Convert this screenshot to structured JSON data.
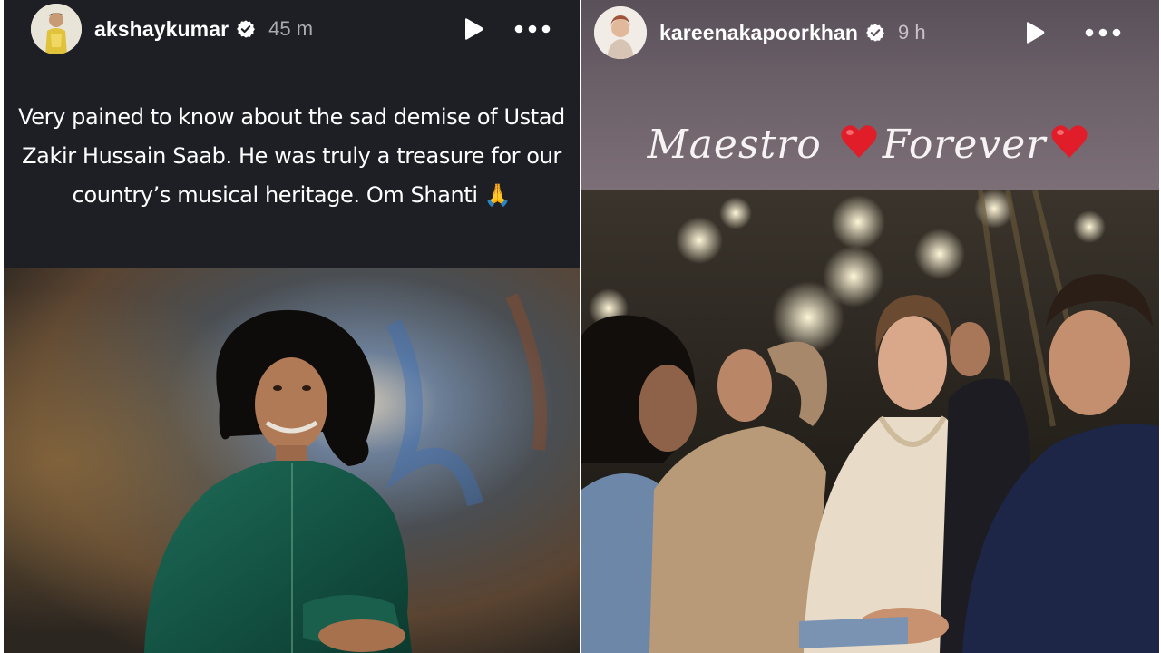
{
  "left_story": {
    "username": "akshaykumar",
    "time": "45 m",
    "caption_lines": [
      "Very pained to know about the sad demise of Ustad",
      "Zakir Hussain Saab. He was truly a treasure for our",
      "country’s musical heritage. Om Shanti 🙏"
    ]
  },
  "right_story": {
    "username": "kareenakapoorkhan",
    "time": "9 h",
    "overlay_text_1": "Maestro",
    "overlay_text_2": "Forever"
  },
  "icons": [
    "verified-badge-icon",
    "play-icon",
    "more-icon",
    "heart-icon",
    "folded-hands-emoji"
  ],
  "colors": {
    "dark_bg": "#1d1f25",
    "verified": "#ffffff",
    "muted_text": "#a9abb2"
  }
}
